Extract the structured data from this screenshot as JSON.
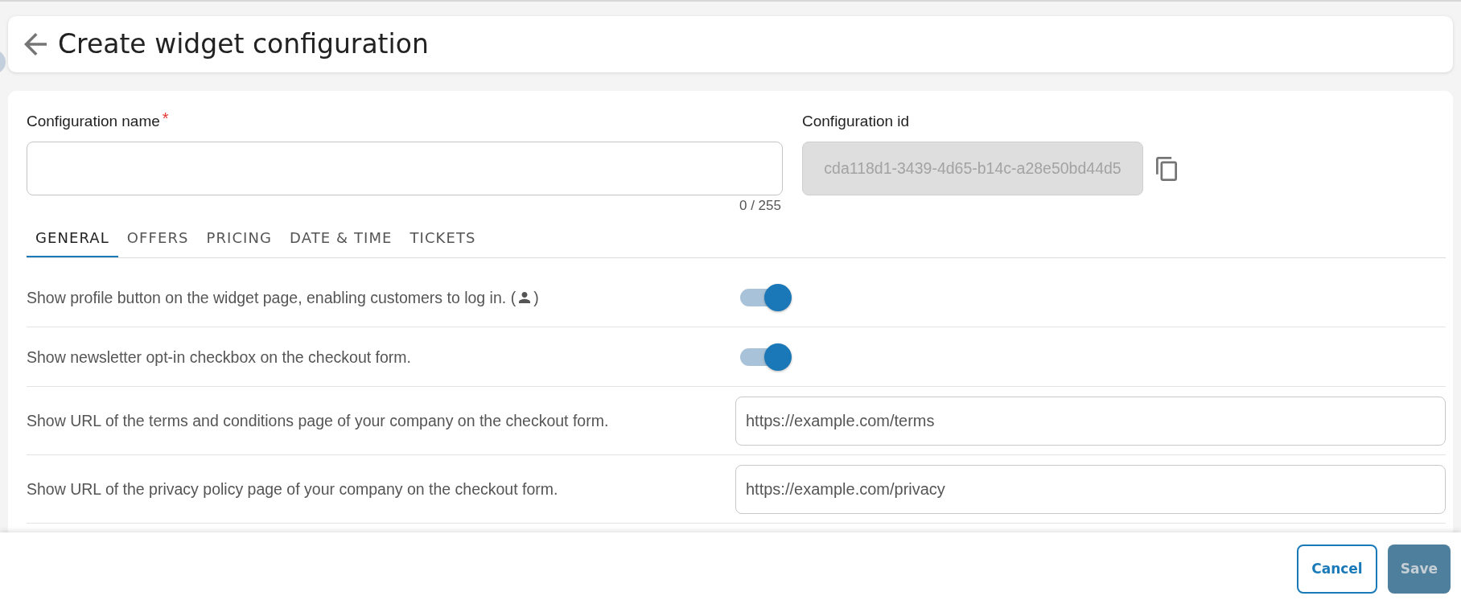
{
  "header": {
    "title": "Create widget configuration"
  },
  "form": {
    "name_field": {
      "label": "Configuration name",
      "required_mark": "*",
      "counter": "0 / 255"
    },
    "id_field": {
      "label": "Configuration id",
      "value": "cda118d1-3439-4d65-b14c-a28e50bd44d5",
      "disabled": true
    }
  },
  "tabs": [
    {
      "label": "GENERAL",
      "selected": true
    },
    {
      "label": "OFFERS",
      "selected": false
    },
    {
      "label": "PRICING",
      "selected": false
    },
    {
      "label": "DATE & TIME",
      "selected": false
    },
    {
      "label": "TICKETS",
      "selected": false
    }
  ],
  "settings": [
    {
      "kind": "toggle",
      "label": "Show profile button on the widget page, enabling customers to log in. (",
      "label_end": ")",
      "on": true
    },
    {
      "kind": "toggle",
      "label": "Show newsletter opt-in checkbox on the checkout form.",
      "on": true
    },
    {
      "kind": "url",
      "label": "Show URL of the terms and conditions page of your company on the checkout form.",
      "value": "https://example.com/terms"
    },
    {
      "kind": "url",
      "label": "Show URL of the privacy policy page of your company on the checkout form.",
      "value": "https://example.com/privacy"
    }
  ],
  "footer": {
    "buttons": [
      {
        "label": "Cancel",
        "kind": "secondary",
        "disabled": false
      },
      {
        "label": "Save",
        "kind": "primary",
        "disabled": true
      }
    ]
  }
}
